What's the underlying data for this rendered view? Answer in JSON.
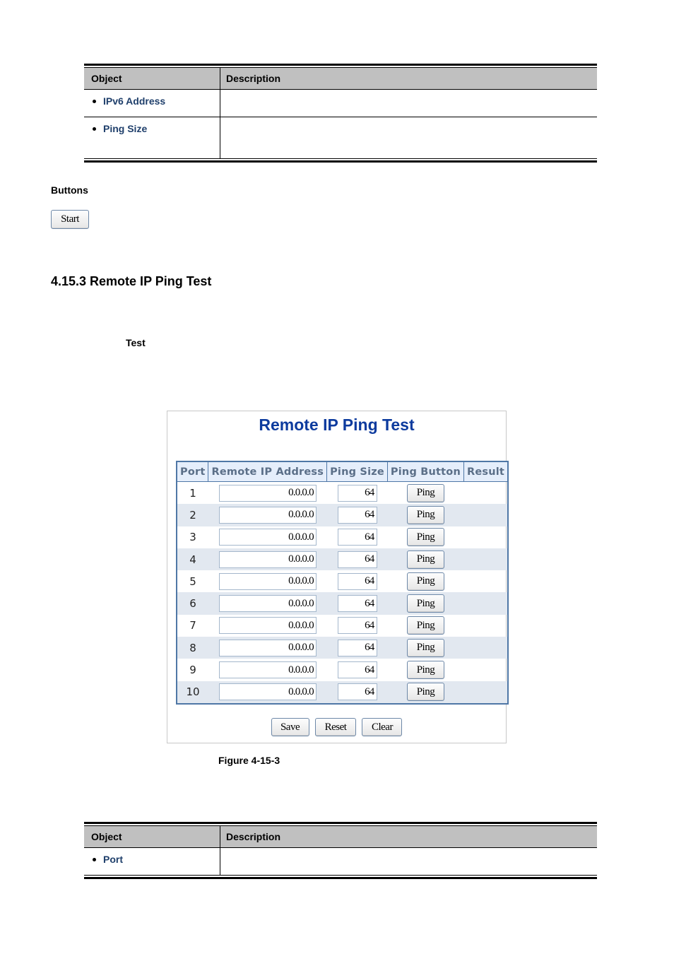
{
  "table1": {
    "headers": [
      "Object",
      "Description"
    ],
    "rows": [
      {
        "object": "IPv6 Address",
        "description": ""
      },
      {
        "object": "Ping Size",
        "description": ""
      }
    ]
  },
  "buttons_section": {
    "label": "Buttons",
    "start_button": "Start"
  },
  "section": {
    "heading": "4.15.3 Remote IP Ping Test",
    "sub_label": "Test"
  },
  "figure": {
    "title": "Remote IP Ping Test",
    "columns": [
      "Port",
      "Remote IP Address",
      "Ping Size",
      "Ping Button",
      "Result"
    ],
    "rows": [
      {
        "port": "1",
        "ip": "0.0.0.0",
        "size": "64",
        "button": "Ping",
        "result": ""
      },
      {
        "port": "2",
        "ip": "0.0.0.0",
        "size": "64",
        "button": "Ping",
        "result": ""
      },
      {
        "port": "3",
        "ip": "0.0.0.0",
        "size": "64",
        "button": "Ping",
        "result": ""
      },
      {
        "port": "4",
        "ip": "0.0.0.0",
        "size": "64",
        "button": "Ping",
        "result": ""
      },
      {
        "port": "5",
        "ip": "0.0.0.0",
        "size": "64",
        "button": "Ping",
        "result": ""
      },
      {
        "port": "6",
        "ip": "0.0.0.0",
        "size": "64",
        "button": "Ping",
        "result": ""
      },
      {
        "port": "7",
        "ip": "0.0.0.0",
        "size": "64",
        "button": "Ping",
        "result": ""
      },
      {
        "port": "8",
        "ip": "0.0.0.0",
        "size": "64",
        "button": "Ping",
        "result": ""
      },
      {
        "port": "9",
        "ip": "0.0.0.0",
        "size": "64",
        "button": "Ping",
        "result": ""
      },
      {
        "port": "10",
        "ip": "0.0.0.0",
        "size": "64",
        "button": "Ping",
        "result": ""
      }
    ],
    "buttons": {
      "save": "Save",
      "reset": "Reset",
      "clear": "Clear"
    },
    "caption": "Figure 4-15-3"
  },
  "table2": {
    "headers": [
      "Object",
      "Description"
    ],
    "rows": [
      {
        "object": "Port",
        "description": ""
      }
    ]
  },
  "colors": {
    "title_blue": "#0d3b9e",
    "object_blue": "#1f3f6b",
    "table_border": "#4f77a6",
    "header_bg": "#c0c0c0",
    "alt_row_bg": "#e2e8f0"
  }
}
